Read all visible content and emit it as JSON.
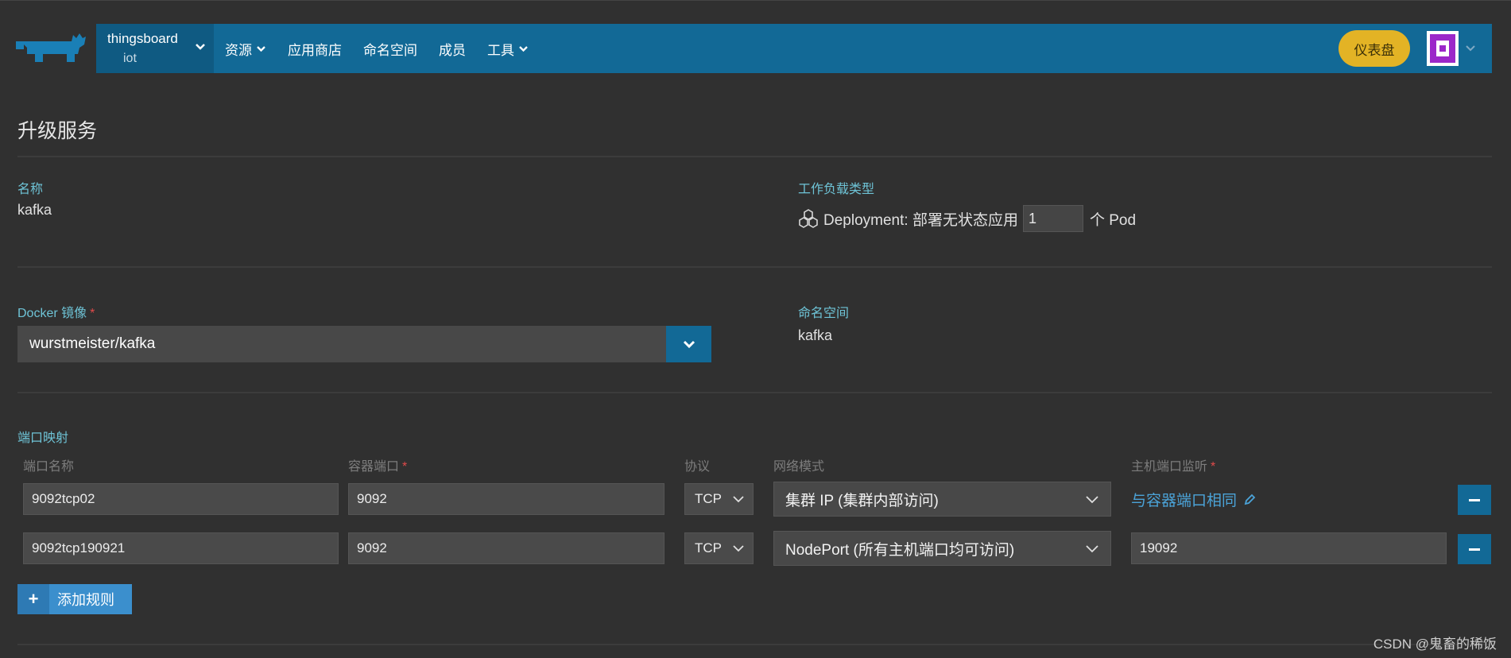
{
  "header": {
    "project_switcher": {
      "cluster": "thingsboard",
      "project": "iot"
    },
    "nav": [
      {
        "label": "资源",
        "has_dropdown": true
      },
      {
        "label": "应用商店",
        "has_dropdown": false
      },
      {
        "label": "命名空间",
        "has_dropdown": false
      },
      {
        "label": "成员",
        "has_dropdown": false
      },
      {
        "label": "工具",
        "has_dropdown": true
      }
    ],
    "dashboard_button": "仪表盘"
  },
  "page": {
    "title": "升级服务",
    "name_label": "名称",
    "name_value": "kafka",
    "workload_label": "工作负载类型",
    "workload_type": "Deployment: 部署无状态应用",
    "scale_value": "1",
    "scale_unit": "个 Pod",
    "docker_label": "Docker 镜像",
    "docker_image": "wurstmeister/kafka",
    "namespace_label": "命名空间",
    "namespace_value": "kafka"
  },
  "ports": {
    "section_label": "端口映射",
    "headers": {
      "name": "端口名称",
      "container_port": "容器端口",
      "protocol": "协议",
      "network_mode": "网络模式",
      "host_port": "主机端口监听"
    },
    "rows": [
      {
        "name": "9092tcp02",
        "container_port": "9092",
        "protocol": "TCP",
        "network_mode": "集群 IP (集群内部访问)",
        "host_port_link": "与容器端口相同"
      },
      {
        "name": "9092tcp190921",
        "container_port": "9092",
        "protocol": "TCP",
        "network_mode": "NodePort (所有主机端口均可访问)",
        "host_port": "19092"
      }
    ],
    "add_rule": "添加规则"
  },
  "watermark": "CSDN @鬼畜的稀饭",
  "colors": {
    "background": "#303030",
    "header": "#126996",
    "accent_label": "#6ec3d6",
    "dashboard_button": "#e3b325",
    "link": "#4ba3d8",
    "required": "#e04a4a"
  }
}
